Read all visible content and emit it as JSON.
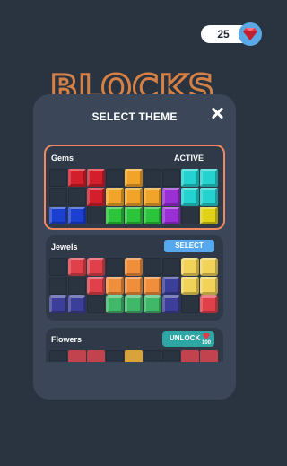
{
  "currency": {
    "gems": "25",
    "icon": "gem-icon"
  },
  "background_logo": "BLOCKS",
  "modal": {
    "title": "SELECT THEME",
    "close_icon": "close-icon"
  },
  "colors": {
    "active_border": "#f08a62",
    "select_button": "#56a9ef",
    "unlock_button": "#2ea6a3"
  },
  "themes": [
    {
      "name": "Gems",
      "status": "ACTIVE",
      "grid": [
        [
          "e",
          "#d31f2b",
          "#d31f2b",
          "e",
          "#f0a52a",
          "e",
          "e",
          "#24d3cf",
          "#24d3cf"
        ],
        [
          "e",
          "e",
          "#d31f2b",
          "#f0a52a",
          "#f0a52a",
          "#f0a52a",
          "#9b2fd6",
          "#24d3cf",
          "#24d3cf"
        ],
        [
          "#1b3fcf",
          "#1b3fcf",
          "e",
          "#2bc43a",
          "#2bc43a",
          "#2bc43a",
          "#9b2fd6",
          "e",
          "#e1d217"
        ]
      ]
    },
    {
      "name": "Jewels",
      "button": "SELECT",
      "grid": [
        [
          "e",
          "#e0404a",
          "#e0404a",
          "e",
          "#ef8f3c",
          "e",
          "e",
          "#f2d35a",
          "#f2d35a"
        ],
        [
          "e",
          "e",
          "#e0404a",
          "#ef8f3c",
          "#ef8f3c",
          "#ef8f3c",
          "#3c3f99",
          "#f2d35a",
          "#f2d35a"
        ],
        [
          "#3c3f99",
          "#3c3f99",
          "e",
          "#3fb86a",
          "#3fb86a",
          "#3fb86a",
          "#3c3f99",
          "e",
          "#e0404a"
        ]
      ]
    },
    {
      "name": "Flowers",
      "button": "UNLOCK",
      "price": "100",
      "grid": [
        [
          "e",
          "#c2434d",
          "#c2434d",
          "e",
          "#d8a33a",
          "e",
          "e",
          "#c2434d",
          "#c2434d"
        ],
        [
          "e",
          "e",
          "#c2434d",
          "#d8a33a",
          "#d8a33a",
          "#d8a33a",
          "e",
          "e",
          "e"
        ],
        [
          "e",
          "e",
          "e",
          "e",
          "e",
          "e",
          "e",
          "e",
          "e"
        ]
      ]
    }
  ]
}
